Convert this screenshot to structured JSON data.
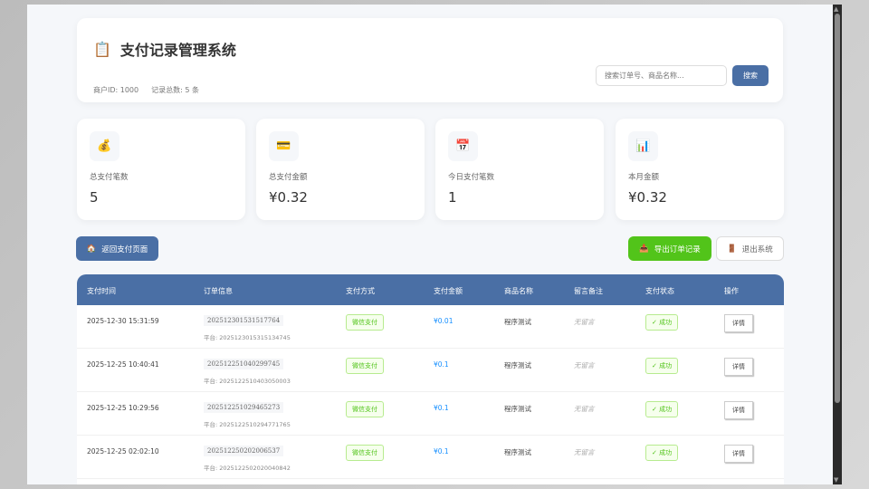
{
  "header": {
    "icon": "clipboard-icon",
    "title": "支付记录管理系统",
    "merchant": "商户ID: 1000",
    "count": "记录总数: 5 条",
    "search_placeholder": "搜索订单号、商品名称...",
    "search_label": "搜索"
  },
  "stats": [
    {
      "icon": "money-bag-icon",
      "glyph": "💰",
      "label": "总支付笔数",
      "value": "5"
    },
    {
      "icon": "credit-card-icon",
      "glyph": "💳",
      "label": "总支付金额",
      "value": "¥0.32"
    },
    {
      "icon": "calendar-icon",
      "glyph": "📅",
      "label": "今日支付笔数",
      "value": "1"
    },
    {
      "icon": "bar-chart-icon",
      "glyph": "📊",
      "label": "本月金额",
      "value": "¥0.32"
    }
  ],
  "actions": {
    "back": "返回支付页面",
    "export": "导出订单记录",
    "logout": "退出系统"
  },
  "table": {
    "headers": [
      "支付时间",
      "订单信息",
      "支付方式",
      "支付金额",
      "商品名称",
      "留言备注",
      "支付状态",
      "操作"
    ],
    "rows": [
      {
        "time": "2025-12-30 15:31:59",
        "order": "202512301531517764",
        "platform": "平台: 2025123015315134745",
        "method": "微信支付",
        "amount": "¥0.01",
        "product": "程序测试",
        "note": "无留言",
        "status": "✓ 成功",
        "action": "详情"
      },
      {
        "time": "2025-12-25 10:40:41",
        "order": "202512251040299745",
        "platform": "平台: 2025122510403050003",
        "method": "微信支付",
        "amount": "¥0.1",
        "product": "程序测试",
        "note": "无留言",
        "status": "✓ 成功",
        "action": "详情"
      },
      {
        "time": "2025-12-25 10:29:56",
        "order": "202512251029465273",
        "platform": "平台: 2025122510294771765",
        "method": "微信支付",
        "amount": "¥0.1",
        "product": "程序测试",
        "note": "无留言",
        "status": "✓ 成功",
        "action": "详情"
      },
      {
        "time": "2025-12-25 02:02:10",
        "order": "202512250202006537",
        "platform": "平台: 2025122502020040842",
        "method": "微信支付",
        "amount": "¥0.1",
        "product": "程序测试",
        "note": "无留言",
        "status": "✓ 成功",
        "action": "详情"
      }
    ]
  }
}
